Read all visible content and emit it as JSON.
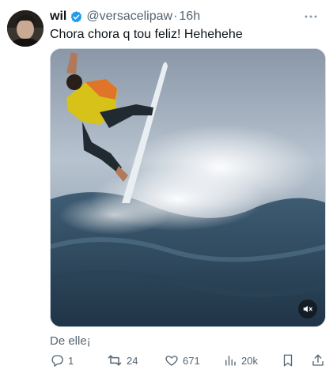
{
  "author": {
    "display_name": "wil",
    "handle": "@versacelipaw",
    "time": "16h",
    "separator": "·",
    "verified": true
  },
  "tweet": {
    "text": "Chora chora q tou feliz! Hehehehe",
    "media_caption": "De elle¡",
    "media_type": "video"
  },
  "actions": {
    "replies": "1",
    "retweets": "24",
    "likes": "671",
    "views": "20k"
  },
  "icons": {
    "verified": "verified-badge-icon",
    "more": "more-options-icon",
    "mute": "volume-muted-icon",
    "reply": "reply-icon",
    "retweet": "retweet-icon",
    "like": "heart-icon",
    "views": "views-chart-icon",
    "bookmark": "bookmark-icon",
    "share": "share-icon"
  },
  "colors": {
    "text_primary": "#0f1419",
    "text_secondary": "#536471",
    "verified_blue": "#1d9bf0",
    "border": "#cfd9de"
  }
}
